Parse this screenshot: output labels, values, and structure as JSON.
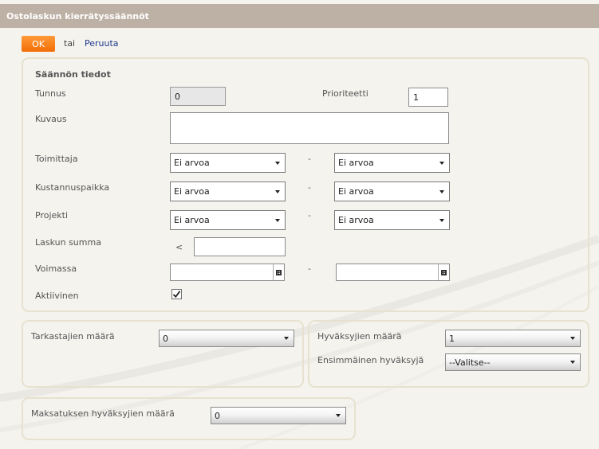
{
  "header": {
    "title": "Ostolaskun kierrätyssäännöt"
  },
  "actions": {
    "ok_label": "OK",
    "or_text": "tai",
    "cancel_label": "Peruuta"
  },
  "rule_details": {
    "section_title": "Säännön tiedot",
    "id_label": "Tunnus",
    "id_value": "0",
    "priority_label": "Prioriteetti",
    "priority_value": "1",
    "description_label": "Kuvaus",
    "description_value": "",
    "supplier_label": "Toimittaja",
    "supplier_from": "Ei arvoa",
    "supplier_to": "Ei arvoa",
    "cost_center_label": "Kustannuspaikka",
    "cost_center_from": "Ei arvoa",
    "cost_center_to": "Ei arvoa",
    "project_label": "Projekti",
    "project_from": "Ei arvoa",
    "project_to": "Ei arvoa",
    "invoice_sum_label": "Laskun summa",
    "invoice_sum_operator": "<",
    "invoice_sum_value": "",
    "valid_label": "Voimassa",
    "valid_from": "",
    "valid_to": "",
    "range_separator": "-",
    "active_label": "Aktiivinen",
    "active_checked": true
  },
  "reviewers": {
    "count_label": "Tarkastajien määrä",
    "count_value": "0"
  },
  "approvers": {
    "count_label": "Hyväksyjien määrä",
    "count_value": "1",
    "first_label": "Ensimmäinen hyväksyjä",
    "first_value": "--Valitse--"
  },
  "payment": {
    "approvers_count_label": "Maksatuksen hyväksyjien määrä",
    "approvers_count_value": "0"
  },
  "icons": {
    "dropdown": "chevron-down-icon",
    "calendar": "calendar-icon",
    "check": "checkmark-icon"
  },
  "colors": {
    "header_bg": "#bdb0a4",
    "ok_button": "#f5770e",
    "link": "#1f3a8a",
    "panel_border": "#e6e2cf"
  }
}
